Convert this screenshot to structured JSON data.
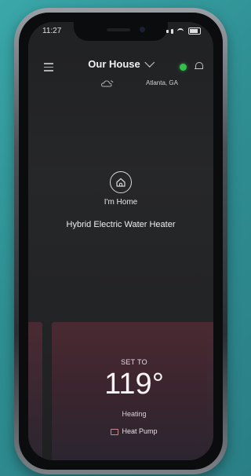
{
  "status_bar": {
    "time": "11:27"
  },
  "header": {
    "title": "Our House",
    "location": "Atlanta, GA"
  },
  "mode": {
    "label": "I'm Home"
  },
  "device": {
    "name": "Hybrid Electric Water Heater"
  },
  "card": {
    "set_to_label": "SET TO",
    "temperature": "119°",
    "state": "Heating",
    "operation_mode": "Heat Pump"
  },
  "colors": {
    "status_ok": "#31c24a",
    "card_top": "#4a2a32",
    "background_teal": "#3aa7a9"
  },
  "icons": {
    "menu": "menu-icon",
    "dropdown": "chevron-down-icon",
    "status": "status-dot",
    "notifications": "bell-icon",
    "weather": "cloud-icon",
    "home_mode": "house-icon",
    "heat_pump": "heat-pump-icon"
  }
}
